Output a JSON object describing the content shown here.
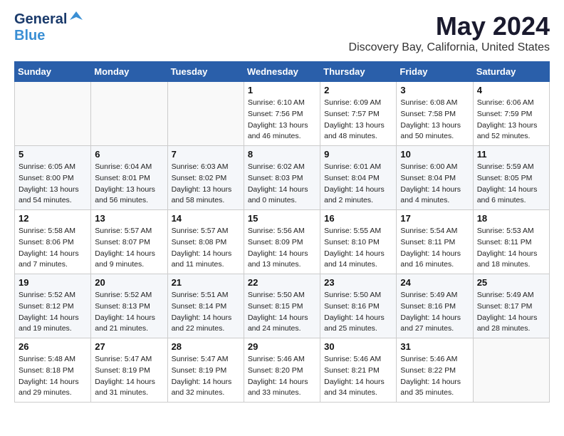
{
  "header": {
    "logo_general": "General",
    "logo_blue": "Blue",
    "month": "May 2024",
    "location": "Discovery Bay, California, United States"
  },
  "weekdays": [
    "Sunday",
    "Monday",
    "Tuesday",
    "Wednesday",
    "Thursday",
    "Friday",
    "Saturday"
  ],
  "weeks": [
    [
      {
        "day": "",
        "info": ""
      },
      {
        "day": "",
        "info": ""
      },
      {
        "day": "",
        "info": ""
      },
      {
        "day": "1",
        "info": "Sunrise: 6:10 AM\nSunset: 7:56 PM\nDaylight: 13 hours\nand 46 minutes."
      },
      {
        "day": "2",
        "info": "Sunrise: 6:09 AM\nSunset: 7:57 PM\nDaylight: 13 hours\nand 48 minutes."
      },
      {
        "day": "3",
        "info": "Sunrise: 6:08 AM\nSunset: 7:58 PM\nDaylight: 13 hours\nand 50 minutes."
      },
      {
        "day": "4",
        "info": "Sunrise: 6:06 AM\nSunset: 7:59 PM\nDaylight: 13 hours\nand 52 minutes."
      }
    ],
    [
      {
        "day": "5",
        "info": "Sunrise: 6:05 AM\nSunset: 8:00 PM\nDaylight: 13 hours\nand 54 minutes."
      },
      {
        "day": "6",
        "info": "Sunrise: 6:04 AM\nSunset: 8:01 PM\nDaylight: 13 hours\nand 56 minutes."
      },
      {
        "day": "7",
        "info": "Sunrise: 6:03 AM\nSunset: 8:02 PM\nDaylight: 13 hours\nand 58 minutes."
      },
      {
        "day": "8",
        "info": "Sunrise: 6:02 AM\nSunset: 8:03 PM\nDaylight: 14 hours\nand 0 minutes."
      },
      {
        "day": "9",
        "info": "Sunrise: 6:01 AM\nSunset: 8:04 PM\nDaylight: 14 hours\nand 2 minutes."
      },
      {
        "day": "10",
        "info": "Sunrise: 6:00 AM\nSunset: 8:04 PM\nDaylight: 14 hours\nand 4 minutes."
      },
      {
        "day": "11",
        "info": "Sunrise: 5:59 AM\nSunset: 8:05 PM\nDaylight: 14 hours\nand 6 minutes."
      }
    ],
    [
      {
        "day": "12",
        "info": "Sunrise: 5:58 AM\nSunset: 8:06 PM\nDaylight: 14 hours\nand 7 minutes."
      },
      {
        "day": "13",
        "info": "Sunrise: 5:57 AM\nSunset: 8:07 PM\nDaylight: 14 hours\nand 9 minutes."
      },
      {
        "day": "14",
        "info": "Sunrise: 5:57 AM\nSunset: 8:08 PM\nDaylight: 14 hours\nand 11 minutes."
      },
      {
        "day": "15",
        "info": "Sunrise: 5:56 AM\nSunset: 8:09 PM\nDaylight: 14 hours\nand 13 minutes."
      },
      {
        "day": "16",
        "info": "Sunrise: 5:55 AM\nSunset: 8:10 PM\nDaylight: 14 hours\nand 14 minutes."
      },
      {
        "day": "17",
        "info": "Sunrise: 5:54 AM\nSunset: 8:11 PM\nDaylight: 14 hours\nand 16 minutes."
      },
      {
        "day": "18",
        "info": "Sunrise: 5:53 AM\nSunset: 8:11 PM\nDaylight: 14 hours\nand 18 minutes."
      }
    ],
    [
      {
        "day": "19",
        "info": "Sunrise: 5:52 AM\nSunset: 8:12 PM\nDaylight: 14 hours\nand 19 minutes."
      },
      {
        "day": "20",
        "info": "Sunrise: 5:52 AM\nSunset: 8:13 PM\nDaylight: 14 hours\nand 21 minutes."
      },
      {
        "day": "21",
        "info": "Sunrise: 5:51 AM\nSunset: 8:14 PM\nDaylight: 14 hours\nand 22 minutes."
      },
      {
        "day": "22",
        "info": "Sunrise: 5:50 AM\nSunset: 8:15 PM\nDaylight: 14 hours\nand 24 minutes."
      },
      {
        "day": "23",
        "info": "Sunrise: 5:50 AM\nSunset: 8:16 PM\nDaylight: 14 hours\nand 25 minutes."
      },
      {
        "day": "24",
        "info": "Sunrise: 5:49 AM\nSunset: 8:16 PM\nDaylight: 14 hours\nand 27 minutes."
      },
      {
        "day": "25",
        "info": "Sunrise: 5:49 AM\nSunset: 8:17 PM\nDaylight: 14 hours\nand 28 minutes."
      }
    ],
    [
      {
        "day": "26",
        "info": "Sunrise: 5:48 AM\nSunset: 8:18 PM\nDaylight: 14 hours\nand 29 minutes."
      },
      {
        "day": "27",
        "info": "Sunrise: 5:47 AM\nSunset: 8:19 PM\nDaylight: 14 hours\nand 31 minutes."
      },
      {
        "day": "28",
        "info": "Sunrise: 5:47 AM\nSunset: 8:19 PM\nDaylight: 14 hours\nand 32 minutes."
      },
      {
        "day": "29",
        "info": "Sunrise: 5:46 AM\nSunset: 8:20 PM\nDaylight: 14 hours\nand 33 minutes."
      },
      {
        "day": "30",
        "info": "Sunrise: 5:46 AM\nSunset: 8:21 PM\nDaylight: 14 hours\nand 34 minutes."
      },
      {
        "day": "31",
        "info": "Sunrise: 5:46 AM\nSunset: 8:22 PM\nDaylight: 14 hours\nand 35 minutes."
      },
      {
        "day": "",
        "info": ""
      }
    ]
  ]
}
